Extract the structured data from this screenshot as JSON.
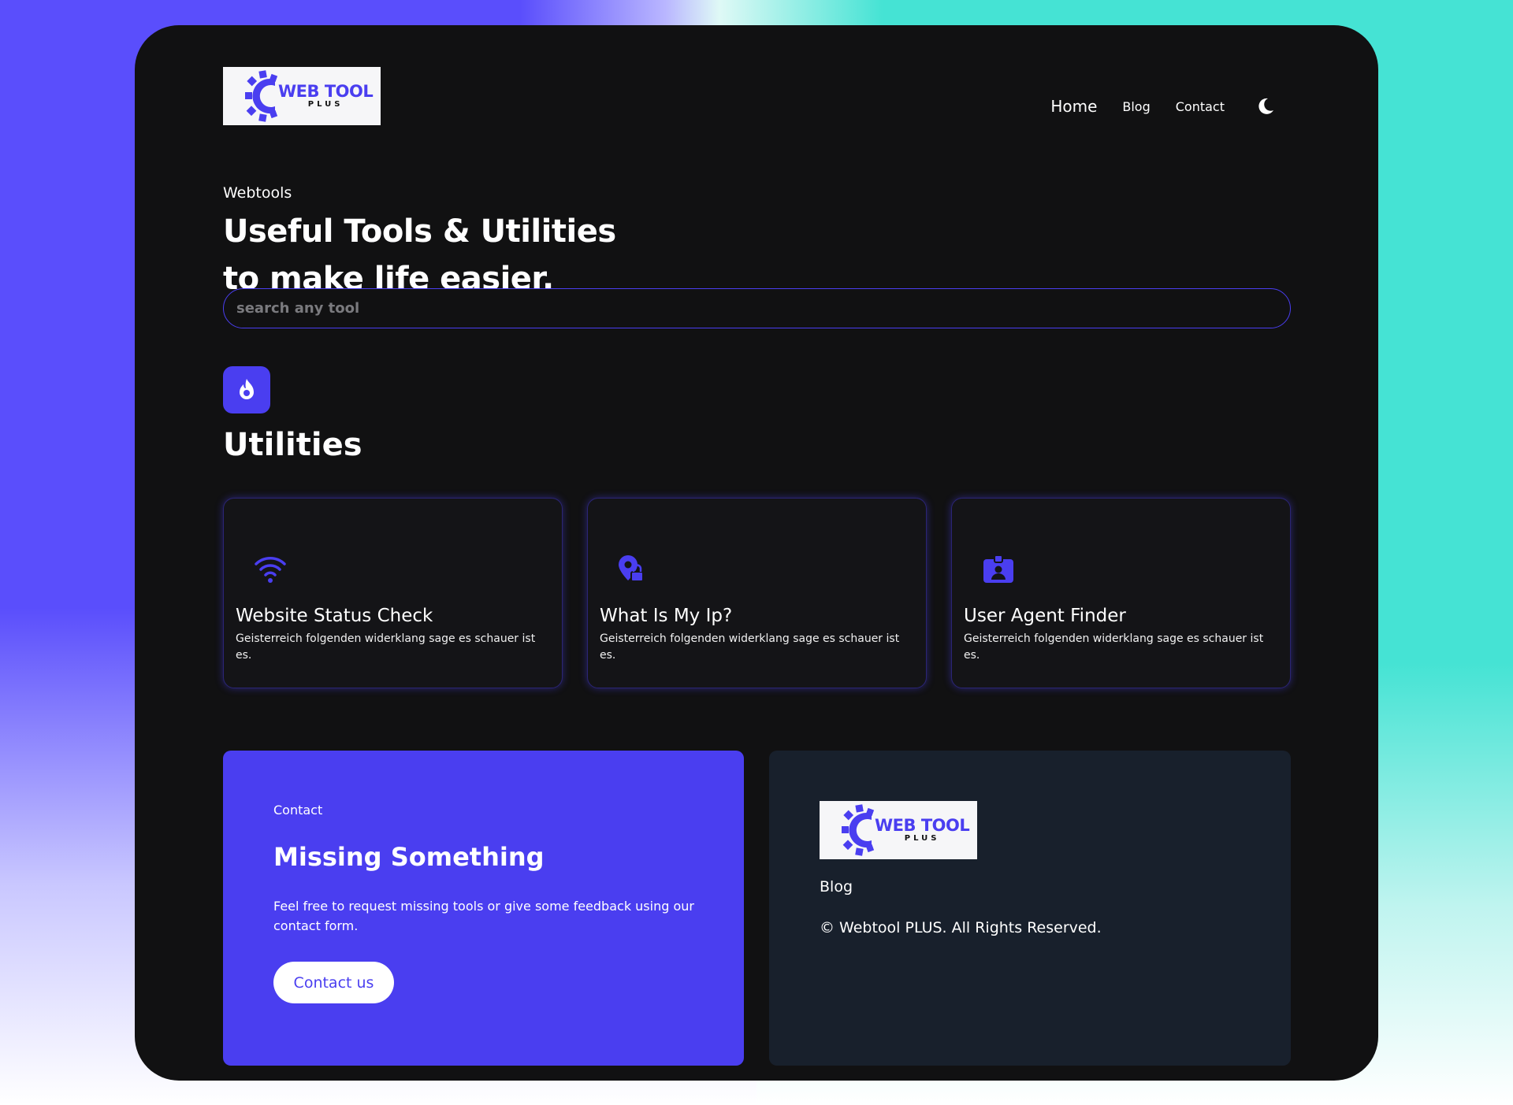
{
  "header": {
    "logo": {
      "main": "WEB TOOL",
      "sub": "PLUS"
    },
    "nav": {
      "home": "Home",
      "blog": "Blog",
      "contact": "Contact"
    },
    "theme_toggle_icon": "moon-icon"
  },
  "hero": {
    "eyebrow": "Webtools",
    "headline_line1": "Useful Tools & Utilities",
    "headline_line2": "to make life easier."
  },
  "search": {
    "placeholder": "search any tool",
    "value": ""
  },
  "section": {
    "icon": "fire-icon",
    "title": "Utilities"
  },
  "tools": [
    {
      "icon": "wifi-icon",
      "title": "Website Status Check",
      "description": "Geisterreich folgenden widerklang sage es schauer ist es."
    },
    {
      "icon": "location-lock-icon",
      "title": "What Is My Ip?",
      "description": "Geisterreich folgenden widerklang sage es schauer ist es."
    },
    {
      "icon": "id-badge-icon",
      "title": "User Agent Finder",
      "description": "Geisterreich folgenden widerklang sage es schauer ist es."
    }
  ],
  "contact_panel": {
    "label": "Contact",
    "title": "Missing Something",
    "text": "Feel free to request missing tools or give some feedback using our contact form.",
    "button": "Contact us"
  },
  "footer": {
    "logo": {
      "main": "WEB TOOL",
      "sub": "PLUS"
    },
    "blog_link": "Blog",
    "copyright": "© Webtool PLUS. All Rights Reserved."
  },
  "colors": {
    "accent": "#4a3ef0",
    "background": "#111112",
    "footer_panel": "#18202c"
  }
}
